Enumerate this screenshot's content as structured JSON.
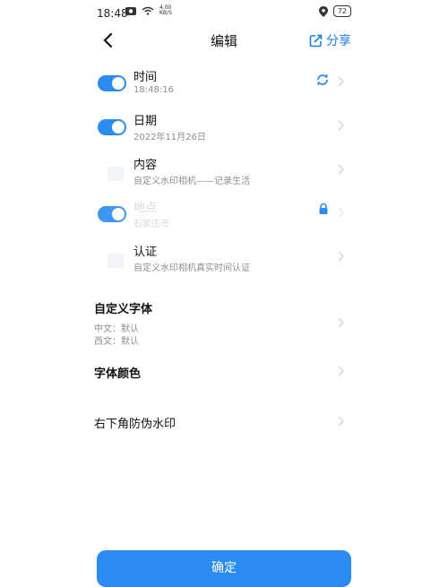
{
  "status_bar": {
    "time": "18:48",
    "speed_top": "4.00",
    "speed_bottom": "KB/S",
    "battery": "72"
  },
  "header": {
    "title": "编辑",
    "share_label": "分享"
  },
  "rows": [
    {
      "title": "时间",
      "subtitle": "18:48:16"
    },
    {
      "title": "日期",
      "subtitle": "2022年11月26日"
    },
    {
      "title": "内容",
      "subtitle": "自定义水印相机——记录生活"
    },
    {
      "title": "地点",
      "subtitle": "石家庄市"
    },
    {
      "title": "认证",
      "subtitle": "自定义水印相机真实时间认证"
    }
  ],
  "font_section": {
    "title": "自定义字体",
    "chinese": "中文：默认",
    "western": "西文：默认"
  },
  "font_color": {
    "title": "字体颜色"
  },
  "anti_fake": {
    "title": "右下角防伪水印"
  },
  "confirm_label": "确定",
  "colors": {
    "accent": "#2a8cf0",
    "share_text": "#1a7ee8"
  }
}
